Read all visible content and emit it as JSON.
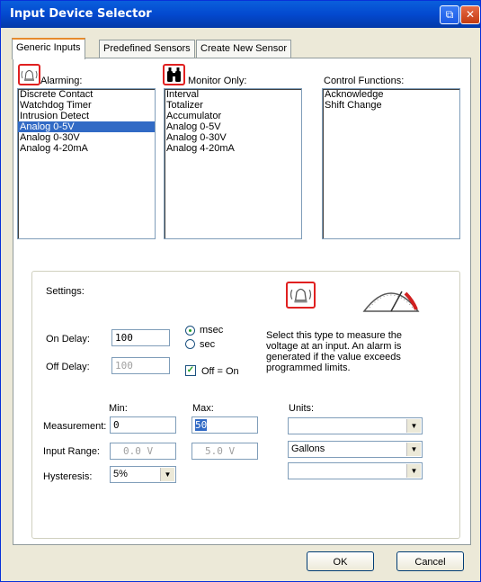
{
  "window": {
    "title": "Input Device Selector"
  },
  "tabs": [
    "Generic Inputs",
    "Predefined Sensors",
    "Create New Sensor"
  ],
  "alarming": {
    "label": "Alarming:",
    "items": [
      "Discrete Contact",
      "Watchdog Timer",
      "Intrusion Detect",
      "Analog 0-5V",
      "Analog 0-30V",
      "Analog 4-20mA"
    ],
    "selected": "Analog 0-5V"
  },
  "monitor": {
    "label": "Monitor Only:",
    "items": [
      "Interval",
      "Totalizer",
      "Accumulator",
      "Analog 0-5V",
      "Analog 0-30V",
      "Analog 4-20mA"
    ]
  },
  "control": {
    "label": "Control Functions:",
    "items": [
      "Acknowledge",
      "Shift Change"
    ]
  },
  "settings": {
    "label": "Settings:",
    "on_delay_label": "On Delay:",
    "on_delay_value": "100",
    "off_delay_label": "Off Delay:",
    "off_delay_value": "100",
    "msec_label": "msec",
    "sec_label": "sec",
    "off_on_label": "Off = On",
    "description": "Select this type to measure the voltage at an input.  An alarm is generated if the value exceeds programmed limits.",
    "min_label": "Min:",
    "max_label": "Max:",
    "units_label": "Units:",
    "measurement_label": "Measurement:",
    "measurement_min": "0",
    "measurement_max": "50",
    "input_range_label": "Input Range:",
    "input_range_min": "0.0 V",
    "input_range_max": "5.0 V",
    "hysteresis_label": "Hysteresis:",
    "hysteresis_value": "5%",
    "units_1": "",
    "units_2": "Gallons",
    "units_3": ""
  },
  "buttons": {
    "ok": "OK",
    "cancel": "Cancel"
  },
  "colors": {
    "title_bar": "#0349cf",
    "selection": "#316ac5",
    "icon_border": "#e02020",
    "tab_highlight": "#e68b2c"
  }
}
